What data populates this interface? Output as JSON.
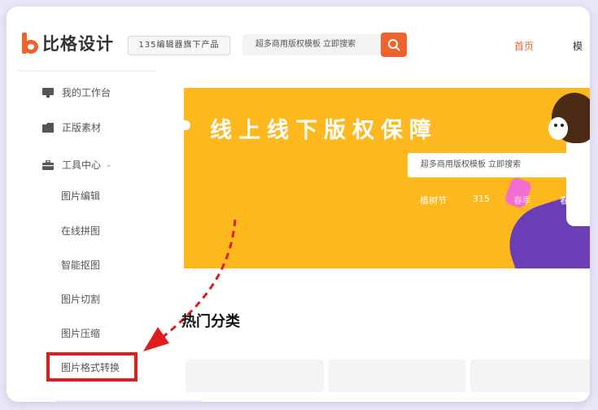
{
  "header": {
    "logo_text": "比格设计",
    "tagline": "135编辑器旗下产品",
    "search_placeholder": "超多商用版权模板 立即搜索",
    "nav_home": "首页",
    "nav_more": "模"
  },
  "sidebar": {
    "workspace": "我的工作台",
    "genuine": "正版素材",
    "tools": "工具中心",
    "sub_items": [
      "图片编辑",
      "在线拼图",
      "智能抠图",
      "图片切割",
      "图片压缩",
      "图片格式转换"
    ]
  },
  "banner": {
    "title": "线上线下版权保障",
    "search_placeholder": "超多商用版权模板 立即搜索",
    "tags": [
      "植树节",
      "315",
      "春季",
      "春天"
    ]
  },
  "main": {
    "section_title": "热门分类"
  },
  "colors": {
    "brand": "#f0622d",
    "banner": "#fdb81e",
    "highlight": "#e01d1d"
  }
}
